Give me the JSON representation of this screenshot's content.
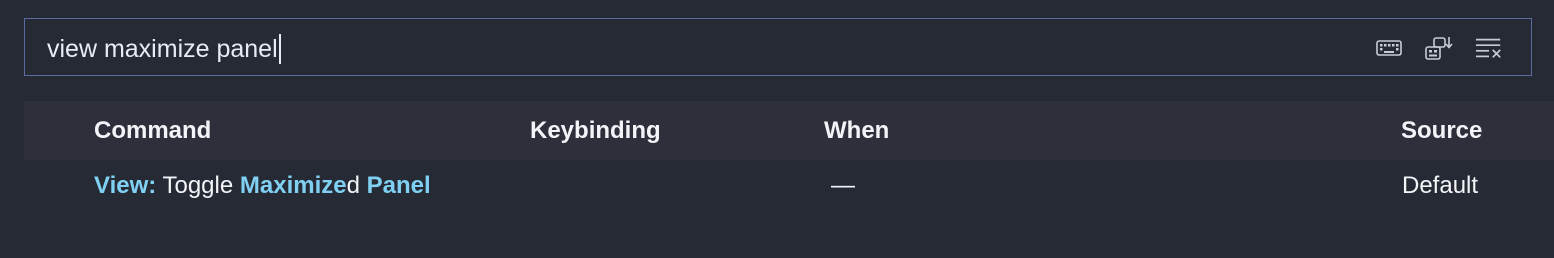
{
  "search": {
    "value": "view maximize panel"
  },
  "toolbar": {
    "icons": [
      "keyboard-icon",
      "sort-by-precedence-icon",
      "clear-filter-icon"
    ]
  },
  "table": {
    "columns": [
      "Command",
      "Keybinding",
      "When",
      "Source"
    ],
    "rows": [
      {
        "command_parts": [
          {
            "text": "View:",
            "highlight": true
          },
          {
            "text": " Toggle ",
            "highlight": false
          },
          {
            "text": "Maximize",
            "highlight": true
          },
          {
            "text": "d ",
            "highlight": false
          },
          {
            "text": "Panel",
            "highlight": true
          }
        ],
        "keybinding": "",
        "when": "—",
        "source": "Default"
      }
    ]
  },
  "colors": {
    "background": "#262a35",
    "header_background": "#2d303b",
    "search_border": "#5a6b9f",
    "highlight": "#7fd0f2",
    "text": "#f2f4f8"
  }
}
